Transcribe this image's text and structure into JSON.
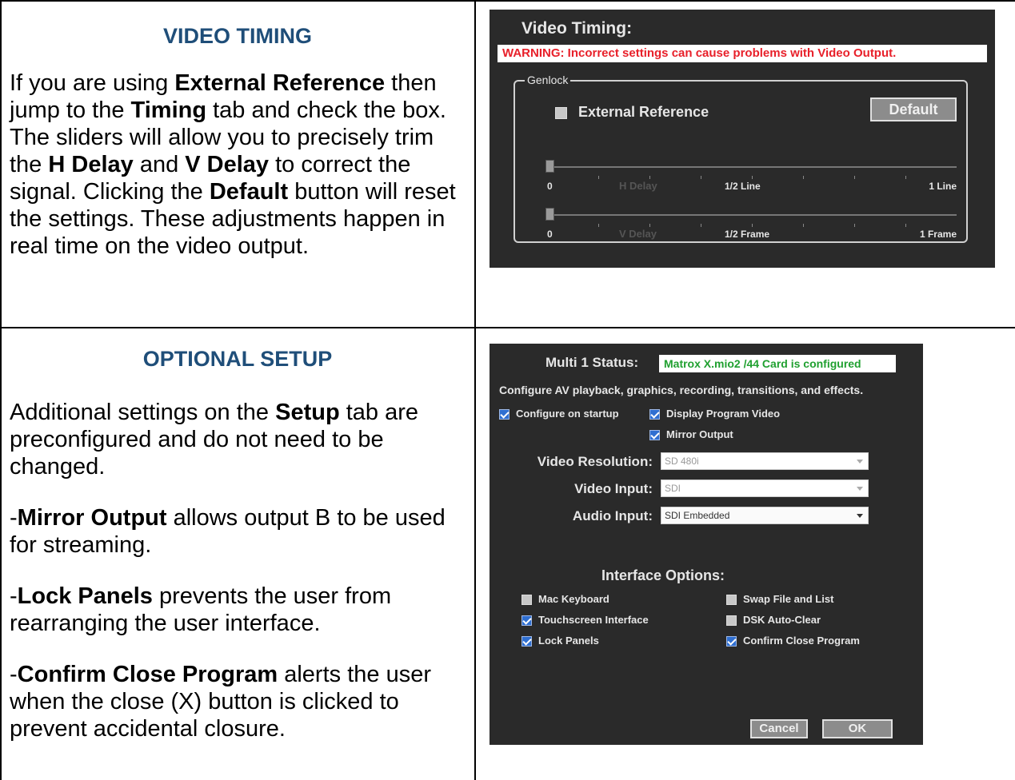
{
  "section1": {
    "heading": "VIDEO TIMING",
    "p": [
      "If you are using ",
      "External Reference",
      " then jump to the ",
      "Timing",
      " tab and check the box.  The sliders will allow you to precisely trim the ",
      "H Delay",
      " and ",
      "V Delay",
      " to correct the signal.  Clicking the ",
      "Default",
      " button will reset the settings.  These adjustments happen in real time on the video output."
    ]
  },
  "video_timing": {
    "title": "Video Timing:",
    "warning": "WARNING: Incorrect settings can cause problems with Video Output.",
    "group": "Genlock",
    "ext_ref": "External Reference",
    "ext_ref_checked": false,
    "default_label": "Default",
    "h_slider": {
      "min": "0",
      "name": "H Delay",
      "mid": "1/2 Line",
      "max": "1 Line",
      "value": 0
    },
    "v_slider": {
      "min": "0",
      "name": "V Delay",
      "mid": "1/2 Frame",
      "max": "1 Frame",
      "value": 0
    }
  },
  "section2": {
    "heading": "OPTIONAL SETUP",
    "p1": [
      "Additional settings on the ",
      "Setup",
      " tab are preconfigured and do not need to be changed."
    ],
    "p2": [
      "-",
      "Mirror Output",
      " allows output B to be used for streaming."
    ],
    "p3": [
      "-",
      "Lock Panels",
      " prevents the user from rearranging the user interface."
    ],
    "p4": [
      "-",
      "Confirm Close Program",
      " alerts the user when the close (X) button is clicked to prevent accidental closure."
    ]
  },
  "setup": {
    "status_label": "Multi 1 Status:",
    "status_value": "Matrox X.mio2 /44 Card is configured",
    "desc": "Configure AV playback, graphics, recording, transitions, and effects.",
    "configure_startup": "Configure on startup",
    "display_program": "Display Program Video",
    "mirror_output": "Mirror Output",
    "res_label": "Video Resolution:",
    "res_value": "SD 480i",
    "vin_label": "Video Input:",
    "vin_value": "SDI",
    "ain_label": "Audio Input:",
    "ain_value": "SDI Embedded",
    "iface_title": "Interface Options:",
    "mac_keyboard": "Mac Keyboard",
    "touchscreen": "Touchscreen Interface",
    "lock_panels": "Lock Panels",
    "swap_file": "Swap File and List",
    "dsk_clear": "DSK Auto-Clear",
    "confirm_close": "Confirm Close Program",
    "cancel": "Cancel",
    "ok": "OK"
  }
}
